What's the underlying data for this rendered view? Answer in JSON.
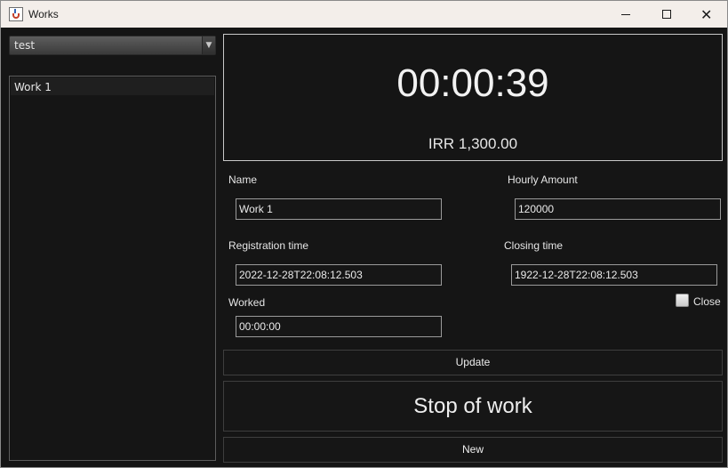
{
  "window": {
    "title": "Works"
  },
  "colors": {
    "background": "#151515",
    "titlebar": "#f3eeea",
    "text": "#e6e6e6",
    "border": "#9a9a9a"
  },
  "sidebar": {
    "combo": {
      "selected": "test"
    },
    "works": [
      {
        "label": "Work 1"
      }
    ]
  },
  "timer": {
    "elapsed": "00:00:39",
    "amount": "IRR 1,300.00"
  },
  "form": {
    "name": {
      "label": "Name",
      "value": "Work 1"
    },
    "hourly_amount": {
      "label": "Hourly Amount",
      "value": "120000"
    },
    "registration_time": {
      "label": "Registration time",
      "value": "2022-12-28T22:08:12.503"
    },
    "closing_time": {
      "label": "Closing time",
      "value": "1922-12-28T22:08:12.503"
    },
    "worked": {
      "label": "Worked",
      "value": "00:00:00"
    },
    "close": {
      "label": "Close",
      "checked": false
    }
  },
  "buttons": {
    "update": "Update",
    "stop": "Stop of work",
    "new": "New"
  }
}
